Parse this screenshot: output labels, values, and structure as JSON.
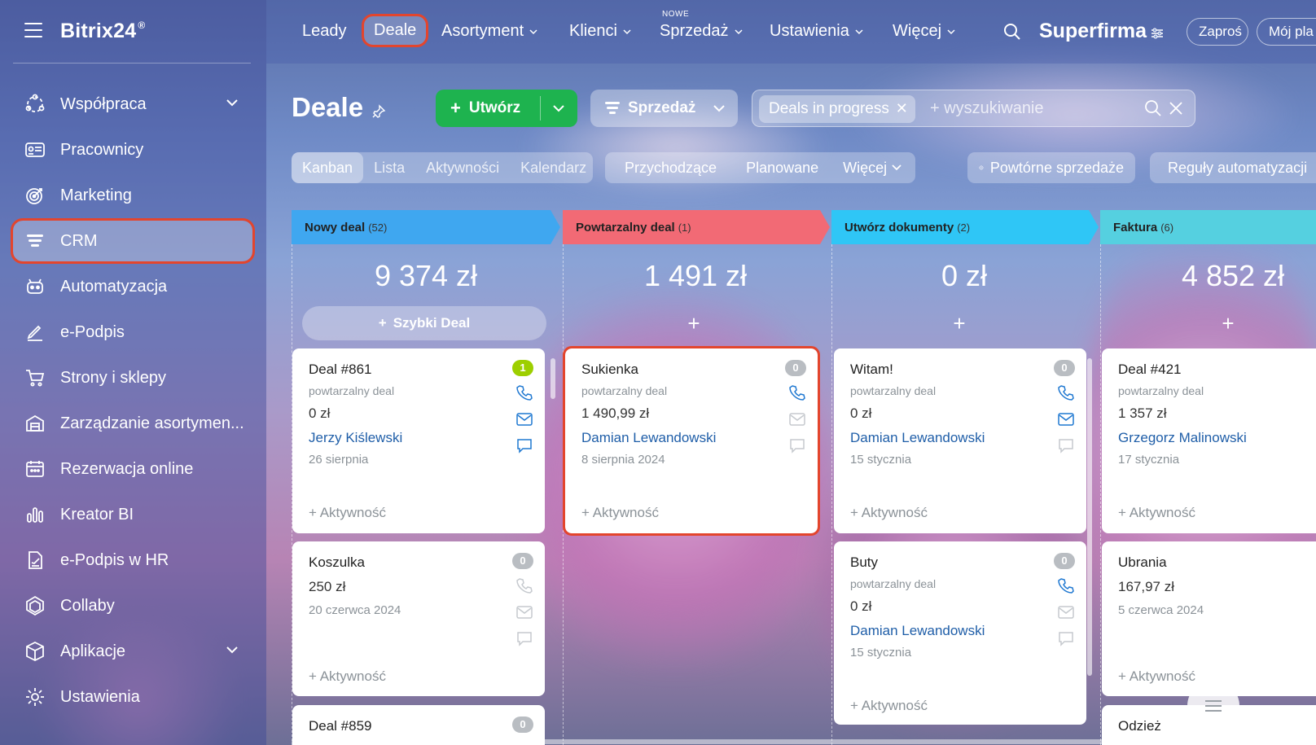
{
  "sidebar": {
    "brand": "Bitrix24",
    "brand_mark": "®",
    "items": [
      {
        "label": "Współpraca",
        "icon": "collaboration-icon",
        "expandable": true
      },
      {
        "label": "Pracownicy",
        "icon": "employees-icon"
      },
      {
        "label": "Marketing",
        "icon": "marketing-icon"
      },
      {
        "label": "CRM",
        "icon": "crm-icon",
        "active": true
      },
      {
        "label": "Automatyzacja",
        "icon": "automation-icon"
      },
      {
        "label": "e-Podpis",
        "icon": "e-signature-icon"
      },
      {
        "label": "Strony i sklepy",
        "icon": "cart-icon"
      },
      {
        "label": "Zarządzanie asortymen...",
        "icon": "inventory-icon"
      },
      {
        "label": "Rezerwacja online",
        "icon": "calendar-icon"
      },
      {
        "label": "Kreator BI",
        "icon": "bi-chart-icon"
      },
      {
        "label": "e-Podpis w HR",
        "icon": "hr-signature-icon"
      },
      {
        "label": "Collaby",
        "icon": "collaby-icon"
      },
      {
        "label": "Aplikacje",
        "icon": "apps-icon",
        "expandable": true
      },
      {
        "label": "Ustawienia",
        "icon": "settings-icon"
      }
    ]
  },
  "topnav": {
    "links": [
      "Leady",
      "Deale",
      "Asortyment",
      "Klienci",
      "Sprzedaż",
      "Ustawienia",
      "Więcej"
    ],
    "active": "Deale",
    "new_badge": "NOWE",
    "company": "Superfirma",
    "invite": "Zaproś",
    "my_plan": "Mój pla"
  },
  "header": {
    "title": "Deale",
    "create_label": "Utwórz",
    "pipeline_label": "Sprzedaż",
    "filter_chip": "Deals in progress",
    "search_placeholder": "+ wyszukiwanie"
  },
  "views": {
    "tabs": [
      "Kanban",
      "Lista",
      "Aktywności",
      "Kalendarz"
    ],
    "active": "Kanban",
    "filters": [
      "Przychodzące",
      "Planowane",
      "Więcej"
    ],
    "repeat_sales": "Powtórne sprzedaże",
    "automation_rules": "Reguły automatyzacji"
  },
  "colors": {
    "accent_green": "#1eb34f",
    "highlight_red": "#e3452d",
    "col_new": "#3fa7f0",
    "col_repeat": "#f26a75",
    "col_docs": "#2fc6f6",
    "col_invoice": "#55d0e0",
    "link_blue": "#1f5ea8"
  },
  "columns": [
    {
      "name": "Nowy deal",
      "count": "(52)",
      "total": "9 374 zł",
      "add": "Szybki Deal",
      "cards": [
        {
          "title": "Deal #861",
          "subtitle": "powtarzalny deal",
          "amount": "0 zł",
          "contact": "Jerzy Kiślewski",
          "date": "26 sierpnia",
          "activity": "+ Aktywność",
          "badge": "1"
        },
        {
          "title": "Koszulka",
          "amount": "250 zł",
          "date": "20 czerwca 2024",
          "activity": "+ Aktywność",
          "badge": "0"
        },
        {
          "title": "Deal #859",
          "badge": "0"
        }
      ]
    },
    {
      "name": "Powtarzalny deal",
      "count": "(1)",
      "total": "1 491 zł",
      "add": "+",
      "cards": [
        {
          "title": "Sukienka",
          "subtitle": "powtarzalny deal",
          "amount": "1 490,99 zł",
          "contact": "Damian Lewandowski",
          "date": "8 sierpnia 2024",
          "activity": "+ Aktywność",
          "badge": "0"
        }
      ]
    },
    {
      "name": "Utwórz dokumenty",
      "count": "(2)",
      "total": "0 zł",
      "add": "+",
      "cards": [
        {
          "title": "Witam!",
          "subtitle": "powtarzalny deal",
          "amount": "0 zł",
          "contact": "Damian Lewandowski",
          "date": "15 stycznia",
          "activity": "+ Aktywność",
          "badge": "0"
        },
        {
          "title": "Buty",
          "subtitle": "powtarzalny deal",
          "amount": "0 zł",
          "contact": "Damian Lewandowski",
          "date": "15 stycznia",
          "activity": "+ Aktywność",
          "badge": "0"
        }
      ]
    },
    {
      "name": "Faktura",
      "count": "(6)",
      "total": "4 852 zł",
      "add": "+",
      "cards": [
        {
          "title": "Deal #421",
          "subtitle": "powtarzalny deal",
          "amount": "1 357 zł",
          "contact": "Grzegorz Malinowski",
          "date": "17 stycznia",
          "activity": "+ Aktywność"
        },
        {
          "title": "Ubrania",
          "amount": "167,97 zł",
          "date": "5 czerwca 2024",
          "activity": "+ Aktywność"
        },
        {
          "title": "Odzież"
        }
      ]
    }
  ]
}
